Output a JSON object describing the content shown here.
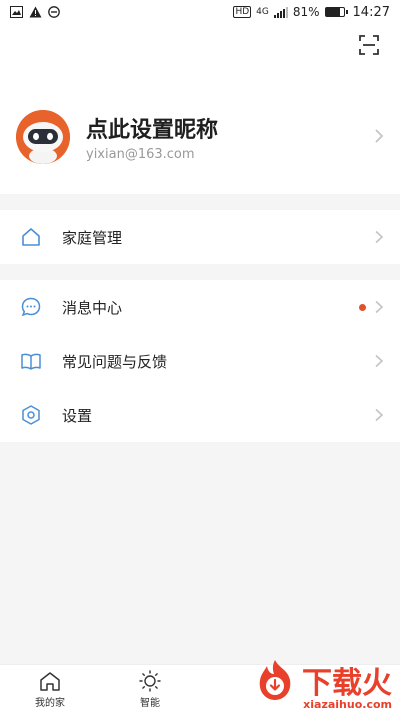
{
  "status_bar": {
    "battery": "81%",
    "battery_level": 0.81,
    "time": "14:27",
    "network": "4G",
    "hd": "HD",
    "icons_left": [
      "image-icon",
      "alert-icon",
      "circle-minus-icon"
    ]
  },
  "profile": {
    "nickname": "点此设置昵称",
    "email": "yixian@163.com",
    "avatar": "robot-avatar-icon"
  },
  "menu": {
    "home_management": "家庭管理",
    "messages": "消息中心",
    "faq": "常见问题与反馈",
    "settings": "设置"
  },
  "tabs": {
    "my_home": "我的家",
    "smart": "智能"
  },
  "watermark": {
    "name": "下载火",
    "domain": "xiazaihuo.com"
  },
  "colors": {
    "accent": "#4a8fd6",
    "badge": "#e0522a",
    "avatar_bg": "#e8632b"
  }
}
